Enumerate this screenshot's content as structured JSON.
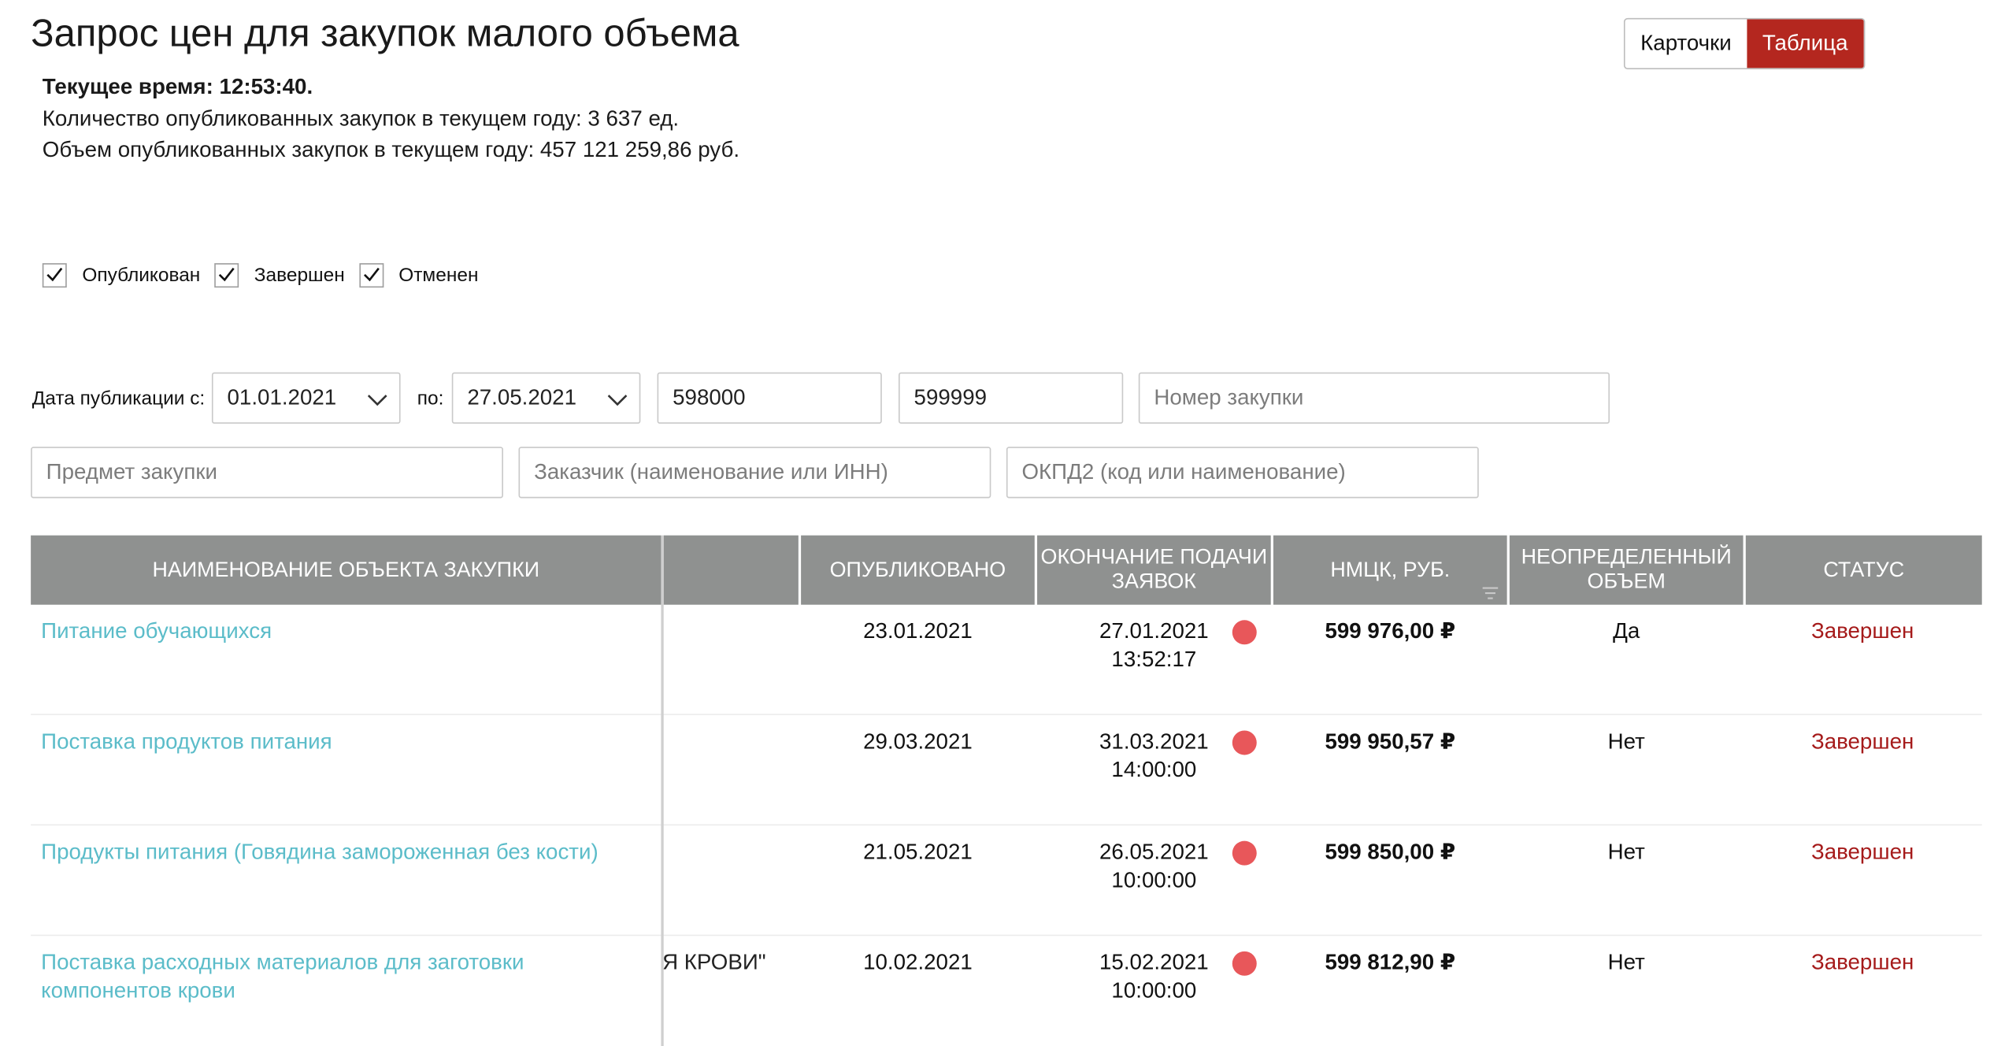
{
  "page": {
    "title": "Запрос цен для закупок малого объема",
    "current_time": "Текущее время: 12:53:40.",
    "count_line": "Количество опубликованных закупок в текущем году: 3 637 ед.",
    "volume_line": "Объем опубликованных закупок в текущем году: 457 121 259,86 руб."
  },
  "view_toggle": {
    "cards": "Карточки",
    "table": "Таблица",
    "active": "table"
  },
  "status_filters": [
    {
      "label": "Опубликован",
      "checked": true
    },
    {
      "label": "Завершен",
      "checked": true
    },
    {
      "label": "Отменен",
      "checked": true
    }
  ],
  "filters": {
    "date_from_label": "Дата публикации с:",
    "date_from": "01.01.2021",
    "date_to_label": "по:",
    "date_to": "27.05.2021",
    "price_min": "598000",
    "price_max": "599999",
    "number_placeholder": "Номер закупки",
    "subject_placeholder": "Предмет закупки",
    "customer_placeholder": "Заказчик (наименование или ИНН)",
    "okpd_placeholder": "ОКПД2 (код или наименование)"
  },
  "table": {
    "columns": [
      "Наименование объекта закупки",
      "Опубликовано",
      "Окончание подачи заявок",
      "НМЦК, руб.",
      "Неопределенный объем",
      "Статус"
    ],
    "rows": [
      {
        "name": "Питание обучающихся",
        "customer": "",
        "published": "23.01.2021",
        "end_date": "27.01.2021",
        "end_time": "13:52:17",
        "price": "599 976,00 ₽",
        "uncertain": "Да",
        "status": "Завершен"
      },
      {
        "name": "Поставка продуктов питания",
        "customer": "",
        "published": "29.03.2021",
        "end_date": "31.03.2021",
        "end_time": "14:00:00",
        "price": "599 950,57 ₽",
        "uncertain": "Нет",
        "status": "Завершен"
      },
      {
        "name": "Продукты питания (Говядина замороженная без кости)",
        "customer": "",
        "published": "21.05.2021",
        "end_date": "26.05.2021",
        "end_time": "10:00:00",
        "price": "599 850,00 ₽",
        "uncertain": "Нет",
        "status": "Завершен"
      },
      {
        "name": "Поставка расходных материалов для заготовки компонентов крови",
        "customer": "Я КРОВИ\"",
        "published": "10.02.2021",
        "end_date": "15.02.2021",
        "end_time": "10:00:00",
        "price": "599 812,90 ₽",
        "uncertain": "Нет",
        "status": "Завершен"
      }
    ]
  },
  "colors": {
    "accent": "#b4271f",
    "header_bg": "#8f9190",
    "link": "#5bbcc9",
    "status": "#a51a1a",
    "dot": "#e8575a"
  }
}
